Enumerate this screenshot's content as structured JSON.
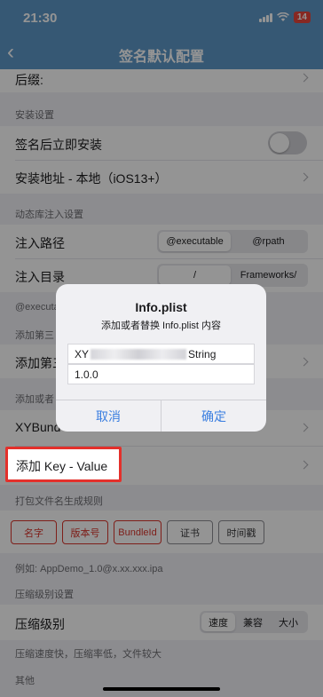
{
  "status": {
    "time": "21:30",
    "battery": "14"
  },
  "nav": {
    "title": "签名默认配置"
  },
  "rows": {
    "suffix": "后缀:",
    "install_after_sign": "签名后立即安装",
    "install_location": "安装地址 - 本地（iOS13+）",
    "inject_path": "注入路径",
    "inject_dir": "注入目录",
    "add_partial": "添加第三",
    "xybundle_partial": "XYBund",
    "add_kv": "添加 Key - Value",
    "compress_level": "压缩级别"
  },
  "sections": {
    "install": "安装设置",
    "dylib": "动态库注入设置",
    "exec_note": "@executa",
    "add_third": "添加第三",
    "add_or": "添加或者",
    "naming": "打包文件名生成规则",
    "example": "例如: AppDemo_1.0@x.xx.xxx.ipa",
    "compress": "压缩级别设置",
    "compress_note": "压缩速度快，压缩率低，文件较大",
    "other": "其他"
  },
  "segments": {
    "path": [
      "@executable",
      "@rpath"
    ],
    "dir": [
      "/",
      "Frameworks/"
    ],
    "compress": [
      "速度",
      "兼容",
      "大小"
    ]
  },
  "chips": {
    "name": "名字",
    "version": "版本号",
    "bundleid": "BundleId",
    "cert": "证书",
    "time": "时间戳"
  },
  "dialog": {
    "title": "Info.plist",
    "message": "添加或者替换 Info.plist 内容",
    "key_prefix": "XY",
    "key_suffix": "String",
    "value": "1.0.0",
    "cancel": "取消",
    "confirm": "确定"
  },
  "colors": {
    "nav": "#5e98c9",
    "highlight": "#e4302b",
    "chip_red": "#d9342b",
    "dialog_button": "#3a7ee0"
  }
}
